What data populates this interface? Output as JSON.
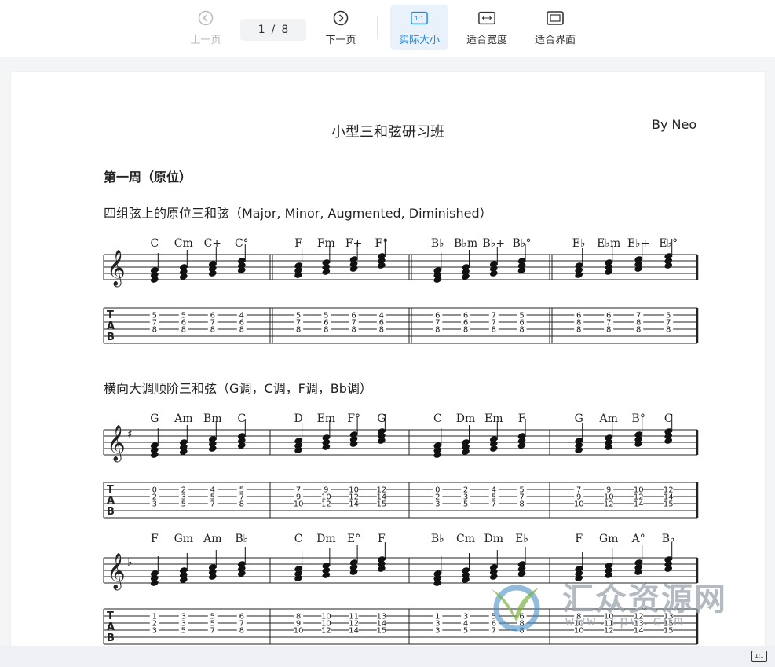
{
  "toolbar": {
    "prev_label": "上一页",
    "next_label": "下一页",
    "page_current": "1",
    "page_sep": "/",
    "page_total": "8",
    "actual_size_label": "实际大小",
    "actual_size_icon_text": "1:1",
    "fit_width_label": "适合宽度",
    "fit_page_label": "适合界面"
  },
  "document": {
    "title": "小型三和弦研习班",
    "author": "By Neo",
    "week_heading": "第一周（原位）",
    "section1_heading": "四组弦上的原位三和弦（Major, Minor, Augmented, Diminished）",
    "section2_heading": "横向大调顺阶三和弦（G调，C调，F调，Bb调）",
    "tab_letters": [
      "T",
      "A",
      "B"
    ],
    "system1": {
      "chords": [
        "C",
        "Cm",
        "C+",
        "C°",
        "F",
        "Fm",
        "F+",
        "F°",
        "B♭",
        "B♭m",
        "B♭+",
        "B♭°",
        "E♭",
        "E♭m",
        "E♭+",
        "E♭°"
      ],
      "tab": [
        [
          "5",
          "7",
          "8"
        ],
        [
          "5",
          "6",
          "8"
        ],
        [
          "6",
          "7",
          "8"
        ],
        [
          "4",
          "6",
          "8"
        ],
        [
          "5",
          "7",
          "8"
        ],
        [
          "5",
          "6",
          "8"
        ],
        [
          "6",
          "7",
          "8"
        ],
        [
          "4",
          "6",
          "8"
        ],
        [
          "6",
          "7",
          "8"
        ],
        [
          "6",
          "6",
          "8"
        ],
        [
          "7",
          "7",
          "8"
        ],
        [
          "5",
          "6",
          "8"
        ],
        [
          "6",
          "8",
          "8"
        ],
        [
          "6",
          "7",
          "8"
        ],
        [
          "7",
          "8",
          "8"
        ],
        [
          "5",
          "7",
          "8"
        ]
      ]
    },
    "system2": {
      "chords": [
        "G",
        "Am",
        "Bm",
        "C",
        "D",
        "Em",
        "F°",
        "G",
        "C",
        "Dm",
        "Em",
        "F",
        "G",
        "Am",
        "B°",
        "C"
      ],
      "tab": [
        [
          "0",
          "2",
          "3"
        ],
        [
          "2",
          "3",
          "5"
        ],
        [
          "4",
          "5",
          "7"
        ],
        [
          "5",
          "7",
          "8"
        ],
        [
          "7",
          "9",
          "10"
        ],
        [
          "9",
          "10",
          "12"
        ],
        [
          "10",
          "12",
          "14"
        ],
        [
          "12",
          "14",
          "15"
        ],
        [
          "0",
          "2",
          "3"
        ],
        [
          "2",
          "3",
          "5"
        ],
        [
          "4",
          "5",
          "7"
        ],
        [
          "5",
          "7",
          "8"
        ],
        [
          "7",
          "9",
          "10"
        ],
        [
          "9",
          "10",
          "12"
        ],
        [
          "10",
          "12",
          "14"
        ],
        [
          "12",
          "14",
          "15"
        ]
      ]
    },
    "system3": {
      "chords": [
        "F",
        "Gm",
        "Am",
        "B♭",
        "C",
        "Dm",
        "E°",
        "F",
        "B♭",
        "Cm",
        "Dm",
        "E♭",
        "F",
        "Gm",
        "A°",
        "B♭"
      ],
      "tab": [
        [
          "1",
          "2",
          "3"
        ],
        [
          "3",
          "3",
          "5"
        ],
        [
          "5",
          "5",
          "7"
        ],
        [
          "6",
          "7",
          "8"
        ],
        [
          "8",
          "9",
          "10"
        ],
        [
          "10",
          "10",
          "12"
        ],
        [
          "11",
          "12",
          "14"
        ],
        [
          "13",
          "14",
          "15"
        ],
        [
          "1",
          "3",
          "3"
        ],
        [
          "3",
          "4",
          "5"
        ],
        [
          "5",
          "6",
          "7"
        ],
        [
          "6",
          "8",
          "8"
        ],
        [
          "8",
          "10",
          "10"
        ],
        [
          "10",
          "11",
          "12"
        ],
        [
          "12",
          "13",
          "14"
        ],
        [
          "13",
          "15",
          "15"
        ]
      ]
    }
  },
  "watermark": {
    "text": "汇众资源网",
    "url": "www.tpw.com"
  },
  "statusbar": {
    "zoom_badge": "1:1"
  }
}
